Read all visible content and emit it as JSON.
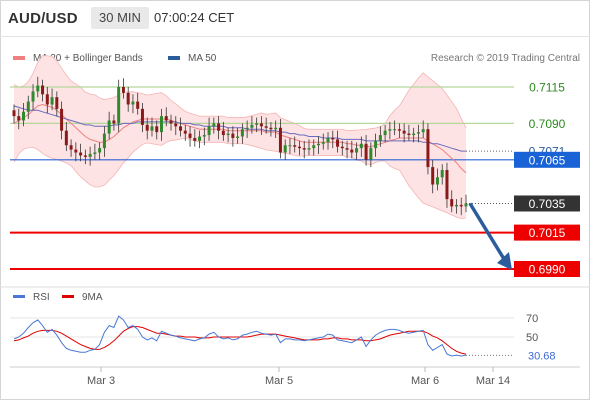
{
  "header": {
    "pair": "AUD/USD",
    "timeframe": "30 MIN",
    "time": "07:00:24 CET"
  },
  "legend": {
    "item1": "MA 20 + Bollinger Bands",
    "item2": "MA 50",
    "credit": "Research © 2019 Trading Central",
    "colors": {
      "item1": "#f08080",
      "item2": "#2c5d9b"
    }
  },
  "rsi_legend": {
    "rsi": "RSI",
    "ma": "9MA",
    "colors": {
      "rsi": "#4a78d4",
      "ma": "#e00000"
    }
  },
  "chart_data": {
    "type": "candlestick",
    "price_axis": {
      "ylim": [
        0.6985,
        0.7125
      ]
    },
    "x_ticks": [
      "Mar 3",
      "Mar 5",
      "Mar 6",
      "Mar 14"
    ],
    "levels": [
      {
        "value": 0.7115,
        "label": "0.7115",
        "kind": "resistance",
        "color": "#b5d89a",
        "tag_bg": "#ffffff",
        "tag_fg": "#2e8b20"
      },
      {
        "value": 0.709,
        "label": "0.7090",
        "kind": "resistance",
        "color": "#b5d89a",
        "tag_bg": "#ffffff",
        "tag_fg": "#2e8b20"
      },
      {
        "value": 0.7071,
        "label": "0.7071",
        "kind": "ma50",
        "color": "#555555",
        "tag_bg": "#ffffff",
        "tag_fg": "#2c5d9b"
      },
      {
        "value": 0.7065,
        "label": "0.7065",
        "kind": "pivot",
        "color": "#2a62d8",
        "tag_bg": "#1a63d6",
        "tag_fg": "#ffffff"
      },
      {
        "value": 0.7035,
        "label": "0.7035",
        "kind": "last",
        "color": "#555555",
        "tag_bg": "#333333",
        "tag_fg": "#ffffff"
      },
      {
        "value": 0.7015,
        "label": "0.7015",
        "kind": "support",
        "color": "#ee0000",
        "tag_bg": "#ee0000",
        "tag_fg": "#ffffff"
      },
      {
        "value": 0.699,
        "label": "0.6990",
        "kind": "support",
        "color": "#ee0000",
        "tag_bg": "#ee0000",
        "tag_fg": "#ffffff"
      }
    ],
    "projection": {
      "from": 0.7035,
      "to": 0.699,
      "color": "#2b5c9c"
    },
    "closes": [
      0.7095,
      0.7092,
      0.7098,
      0.7105,
      0.7112,
      0.7116,
      0.711,
      0.7103,
      0.7108,
      0.71,
      0.7085,
      0.7075,
      0.7072,
      0.707,
      0.7068,
      0.7067,
      0.7069,
      0.707,
      0.7073,
      0.7083,
      0.7092,
      0.709,
      0.7115,
      0.7111,
      0.7103,
      0.7105,
      0.71,
      0.7089,
      0.7085,
      0.7088,
      0.7084,
      0.7095,
      0.7092,
      0.709,
      0.7088,
      0.7085,
      0.7083,
      0.708,
      0.7078,
      0.7081,
      0.7082,
      0.7088,
      0.709,
      0.7085,
      0.7082,
      0.7083,
      0.708,
      0.7081,
      0.7086,
      0.7087,
      0.7089,
      0.709,
      0.7088,
      0.7087,
      0.7086,
      0.7087,
      0.707,
      0.7075,
      0.7075,
      0.7074,
      0.7073,
      0.7072,
      0.7073,
      0.7075,
      0.7076,
      0.7077,
      0.708,
      0.7079,
      0.7074,
      0.7073,
      0.7072,
      0.707,
      0.7073,
      0.7076,
      0.7065,
      0.7073,
      0.7078,
      0.7082,
      0.7085,
      0.7086,
      0.7086,
      0.7085,
      0.7083,
      0.7082,
      0.7083,
      0.7084,
      0.7086,
      0.706,
      0.7048,
      0.7053,
      0.7058,
      0.7038,
      0.7033,
      0.7034,
      0.7033,
      0.7035
    ],
    "ma20": [
      0.709,
      0.7092,
      0.7094,
      0.7096,
      0.7099,
      0.7102,
      0.7103,
      0.7102,
      0.7101,
      0.7099,
      0.7096,
      0.7093,
      0.709,
      0.7087,
      0.7084,
      0.7081,
      0.7079,
      0.7078,
      0.7077,
      0.7077,
      0.7079,
      0.7081,
      0.7084,
      0.7087,
      0.7089,
      0.7091,
      0.7092,
      0.7093,
      0.7093,
      0.7093,
      0.7093,
      0.7093,
      0.7093,
      0.7092,
      0.7091,
      0.709,
      0.7089,
      0.7088,
      0.7087,
      0.7086,
      0.7086,
      0.7086,
      0.7086,
      0.7086,
      0.7086,
      0.7085,
      0.7085,
      0.7085,
      0.7085,
      0.7085,
      0.7085,
      0.7085,
      0.7085,
      0.7084,
      0.7084,
      0.7084,
      0.7082,
      0.7081,
      0.708,
      0.7079,
      0.7078,
      0.7077,
      0.7077,
      0.7077,
      0.7077,
      0.7077,
      0.7077,
      0.7077,
      0.7077,
      0.7077,
      0.7076,
      0.7076,
      0.7075,
      0.7075,
      0.7074,
      0.7074,
      0.7075,
      0.7076,
      0.7077,
      0.7078,
      0.7079,
      0.708,
      0.708,
      0.708,
      0.708,
      0.708,
      0.708,
      0.7078,
      0.7076,
      0.7074,
      0.7072,
      0.7069,
      0.7066,
      0.7063,
      0.7059,
      0.7056
    ],
    "ma50": [
      0.7102,
      0.7101,
      0.71,
      0.7099,
      0.7099,
      0.7099,
      0.7098,
      0.7097,
      0.7096,
      0.7095,
      0.7094,
      0.7093,
      0.7092,
      0.7091,
      0.709,
      0.7089,
      0.7089,
      0.7088,
      0.7088,
      0.7088,
      0.7088,
      0.7089,
      0.7089,
      0.709,
      0.709,
      0.709,
      0.7091,
      0.7091,
      0.7091,
      0.7091,
      0.7091,
      0.7091,
      0.7091,
      0.7091,
      0.7091,
      0.709,
      0.709,
      0.709,
      0.7089,
      0.7089,
      0.7088,
      0.7088,
      0.7088,
      0.7088,
      0.7088,
      0.7087,
      0.7087,
      0.7087,
      0.7087,
      0.7086,
      0.7086,
      0.7086,
      0.7086,
      0.7085,
      0.7085,
      0.7085,
      0.7084,
      0.7084,
      0.7083,
      0.7083,
      0.7082,
      0.7082,
      0.7081,
      0.7081,
      0.7081,
      0.708,
      0.708,
      0.708,
      0.708,
      0.7079,
      0.7079,
      0.7079,
      0.7079,
      0.7079,
      0.7078,
      0.7078,
      0.7078,
      0.7078,
      0.7078,
      0.7078,
      0.7078,
      0.7078,
      0.7078,
      0.7078,
      0.7078,
      0.7078,
      0.7077,
      0.7077,
      0.7076,
      0.7076,
      0.7075,
      0.7074,
      0.7073,
      0.7072,
      0.7071,
      0.7071
    ],
    "rsi": {
      "levels": [
        70,
        50
      ],
      "level_labels": [
        "70",
        "50"
      ],
      "last": 30.68,
      "last_label": "30.68",
      "ylim": [
        20,
        80
      ],
      "values": [
        48,
        50,
        54,
        60,
        65,
        68,
        62,
        55,
        58,
        52,
        44,
        38,
        36,
        35,
        34,
        34,
        36,
        37,
        42,
        55,
        62,
        60,
        72,
        68,
        60,
        62,
        58,
        50,
        47,
        49,
        46,
        56,
        54,
        52,
        51,
        49,
        48,
        47,
        46,
        48,
        49,
        53,
        55,
        50,
        48,
        49,
        47,
        48,
        52,
        53,
        55,
        56,
        54,
        53,
        52,
        53,
        44,
        48,
        48,
        47,
        47,
        46,
        47,
        48,
        49,
        50,
        53,
        52,
        47,
        46,
        45,
        44,
        47,
        50,
        40,
        47,
        52,
        55,
        57,
        58,
        58,
        57,
        55,
        54,
        55,
        56,
        57,
        42,
        36,
        39,
        42,
        32,
        30,
        31,
        30,
        31
      ],
      "ma9": [
        46,
        47,
        49,
        51,
        54,
        56,
        57,
        57,
        57,
        56,
        54,
        51,
        48,
        45,
        42,
        40,
        38,
        37,
        37,
        39,
        42,
        46,
        51,
        56,
        59,
        61,
        61,
        60,
        58,
        56,
        54,
        54,
        53,
        52,
        51,
        51,
        50,
        50,
        50,
        49,
        49,
        49,
        50,
        50,
        50,
        50,
        50,
        50,
        50,
        50,
        51,
        52,
        53,
        53,
        53,
        53,
        52,
        51,
        50,
        49,
        48,
        47,
        47,
        47,
        47,
        48,
        48,
        49,
        49,
        48,
        48,
        47,
        47,
        47,
        46,
        46,
        47,
        48,
        50,
        52,
        53,
        54,
        55,
        56,
        56,
        56,
        56,
        54,
        51,
        49,
        46,
        42,
        38,
        35,
        33,
        32
      ]
    }
  }
}
